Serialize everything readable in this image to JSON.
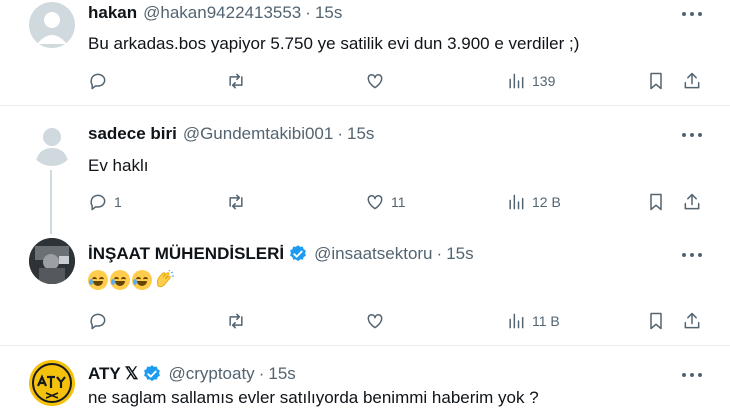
{
  "tweets": [
    {
      "name": "hakan",
      "handle": "@hakan9422413553",
      "time": "15s",
      "text": "Bu arkadas.bos yapiyor 5.750 ye satilik evi dun 3.900 e verdiler ;)",
      "replies": "",
      "retweets": "",
      "likes": "",
      "views": "139"
    },
    {
      "name": "sadece biri",
      "handle": "@Gundemtakibi001",
      "time": "15s",
      "text": "Ev haklı",
      "replies": "1",
      "retweets": "",
      "likes": "11",
      "views": "12 B"
    },
    {
      "name": "İNŞAAT MÜHENDİSLERİ",
      "handle": "@insaatsektoru",
      "time": "15s",
      "text": "",
      "emoji_names": [
        "face-with-tears-of-joy",
        "face-with-tears-of-joy",
        "face-with-tears-of-joy",
        "clapping-hands"
      ],
      "replies": "",
      "retweets": "",
      "likes": "",
      "views": "11 B",
      "verified": true
    },
    {
      "name": "ATY",
      "name_suffix": "𝕏",
      "handle": "@cryptoaty",
      "time": "15s",
      "text": "ne saglam sallamıs evler satılıyorda benimmi haberim yok ?",
      "verified": true
    }
  ],
  "dot": "·",
  "colors": {
    "text": "#0f1419",
    "secondary": "#536471",
    "verified": "#1d9bf0",
    "aty_logo_bg": "#f4c20d"
  }
}
